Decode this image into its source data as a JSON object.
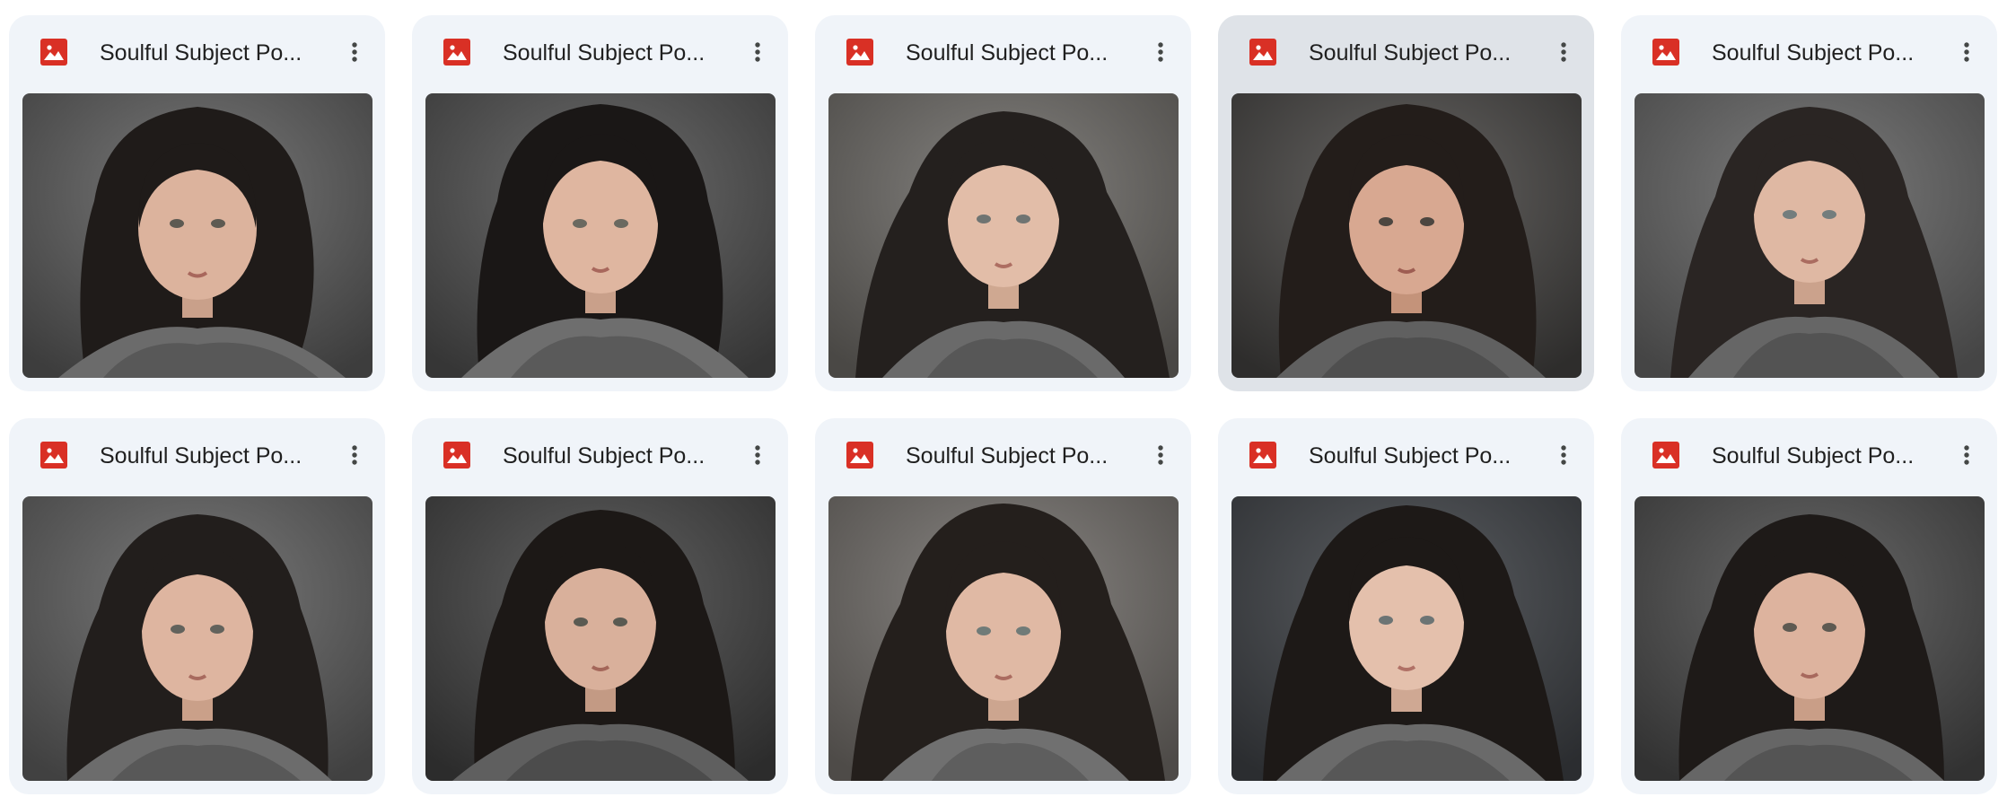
{
  "colors": {
    "card_bg": "#f0f4f9",
    "card_hover_bg": "#dfe3e8",
    "image_icon_red": "#d93025",
    "title_text": "#1f1f1f",
    "icon_gray": "#444746"
  },
  "files": [
    {
      "title": "Soulful Subject Po...",
      "file_icon": "image-file-icon",
      "menu_icon": "more-vert-icon",
      "thumb": "portrait-photo"
    },
    {
      "title": "Soulful Subject Po...",
      "file_icon": "image-file-icon",
      "menu_icon": "more-vert-icon",
      "thumb": "portrait-photo"
    },
    {
      "title": "Soulful Subject Po...",
      "file_icon": "image-file-icon",
      "menu_icon": "more-vert-icon",
      "thumb": "portrait-photo"
    },
    {
      "title": "Soulful Subject Po...",
      "file_icon": "image-file-icon",
      "menu_icon": "more-vert-icon",
      "thumb": "portrait-photo",
      "hovered": true
    },
    {
      "title": "Soulful Subject Po...",
      "file_icon": "image-file-icon",
      "menu_icon": "more-vert-icon",
      "thumb": "portrait-photo"
    },
    {
      "title": "Soulful Subject Po...",
      "file_icon": "image-file-icon",
      "menu_icon": "more-vert-icon",
      "thumb": "portrait-photo"
    },
    {
      "title": "Soulful Subject Po...",
      "file_icon": "image-file-icon",
      "menu_icon": "more-vert-icon",
      "thumb": "portrait-photo"
    },
    {
      "title": "Soulful Subject Po...",
      "file_icon": "image-file-icon",
      "menu_icon": "more-vert-icon",
      "thumb": "portrait-photo"
    },
    {
      "title": "Soulful Subject Po...",
      "file_icon": "image-file-icon",
      "menu_icon": "more-vert-icon",
      "thumb": "portrait-photo"
    },
    {
      "title": "Soulful Subject Po...",
      "file_icon": "image-file-icon",
      "menu_icon": "more-vert-icon",
      "thumb": "portrait-photo"
    }
  ]
}
